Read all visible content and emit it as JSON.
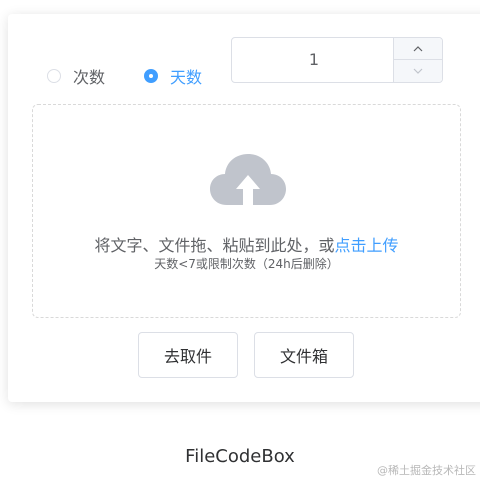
{
  "radio_times": {
    "label": "次数",
    "checked": false
  },
  "radio_days": {
    "label": "天数",
    "checked": true
  },
  "number_input": {
    "value": "1"
  },
  "dropzone": {
    "text_prefix": "将文字、文件拖、粘贴到此处，或",
    "text_link": "点击上传",
    "tip": "天数<7或限制次数（24h后删除）"
  },
  "buttons": {
    "retrieve": "去取件",
    "filebox": "文件箱"
  },
  "footer": {
    "title": "FileCodeBox"
  },
  "watermark": "@稀土掘金技术社区",
  "colors": {
    "accent": "#409eff",
    "icon_gray": "#c0c4cc",
    "border": "#dcdfe6"
  }
}
